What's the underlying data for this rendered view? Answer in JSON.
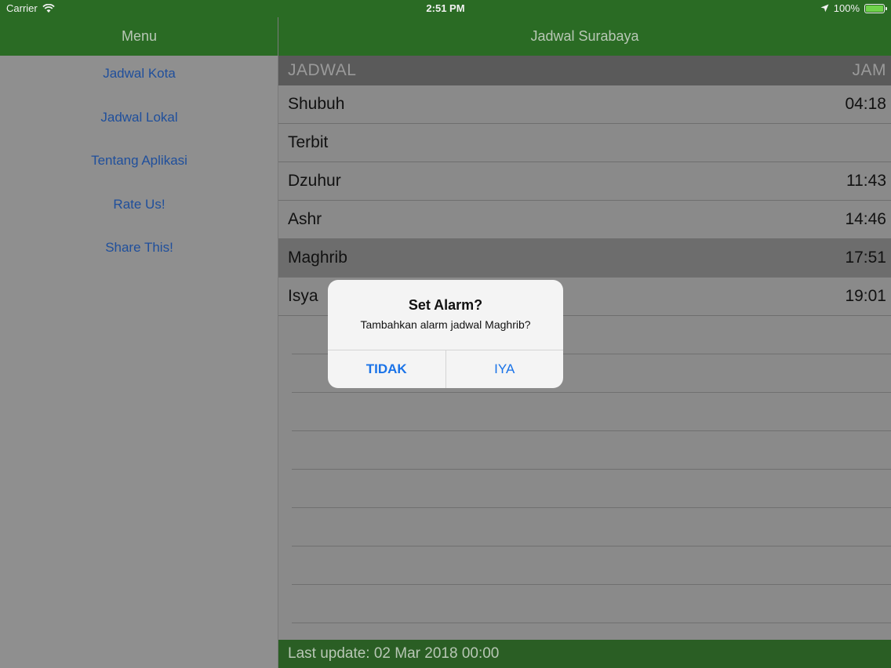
{
  "status_bar": {
    "carrier": "Carrier",
    "time": "2:51 PM",
    "battery": "100%"
  },
  "sidebar": {
    "title": "Menu",
    "items": [
      {
        "label": "Jadwal Kota"
      },
      {
        "label": "Jadwal Lokal"
      },
      {
        "label": "Tentang Aplikasi"
      },
      {
        "label": "Rate Us!"
      },
      {
        "label": "Share This!"
      }
    ]
  },
  "main": {
    "title": "Jadwal Surabaya",
    "header": {
      "left": "JADWAL",
      "right": "JAM"
    },
    "rows": [
      {
        "name": "Shubuh",
        "time": "04:18"
      },
      {
        "name": "Terbit",
        "time": ""
      },
      {
        "name": "Dzuhur",
        "time": "11:43"
      },
      {
        "name": "Ashr",
        "time": "14:46"
      },
      {
        "name": "Maghrib",
        "time": "17:51"
      },
      {
        "name": "Isya",
        "time": "19:01"
      }
    ],
    "footer": "Last update: 02 Mar 2018 00:00"
  },
  "alert": {
    "title": "Set Alarm?",
    "message": "Tambahkan alarm jadwal Maghrib?",
    "cancel_label": "TIDAK",
    "confirm_label": "IYA"
  },
  "colors": {
    "nav_green": "#2a6b24",
    "link_blue": "#1f4f9c",
    "alert_button_blue": "#1a73e8"
  }
}
